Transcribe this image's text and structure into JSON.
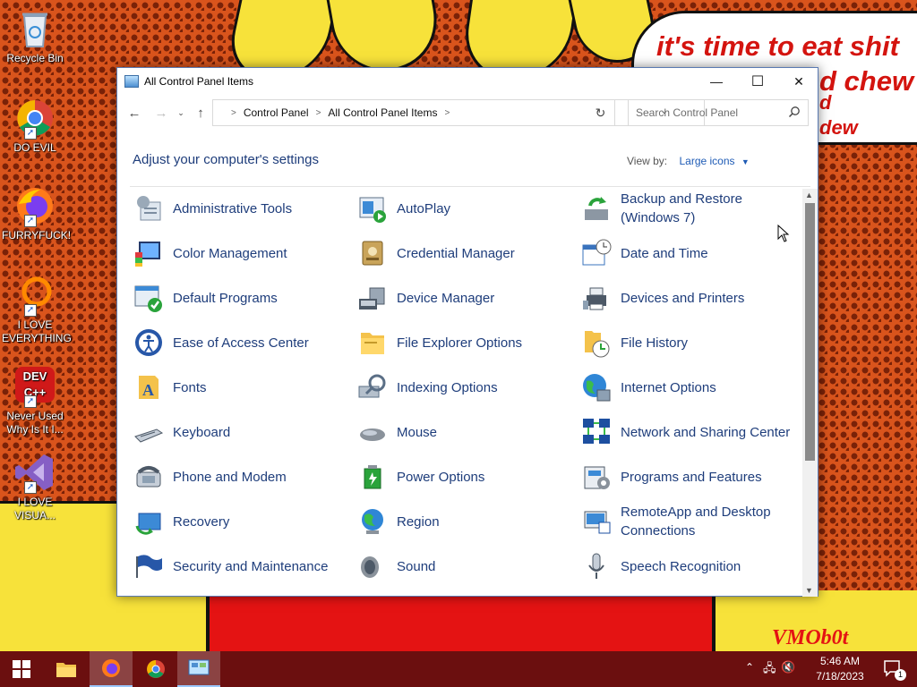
{
  "wallpaper": {
    "caption_line1": "it's time to eat shit",
    "caption_line2": "d chew",
    "caption_line3": "d",
    "caption_line4": "dew",
    "signature": "VMOb0t"
  },
  "desktop_icons": [
    {
      "label": "Recycle Bin",
      "icon": "recycle-bin-icon"
    },
    {
      "label": "DO EVIL",
      "icon": "chrome-icon"
    },
    {
      "label": "FURRYFUCK!",
      "icon": "firefox-icon"
    },
    {
      "label": "I LOVE EVERYTHING",
      "icon": "ring-icon"
    },
    {
      "label": "Never Used Why Is It I...",
      "icon": "devcpp-icon"
    },
    {
      "label": "I LOVE VISUA...",
      "icon": "visual-studio-icon"
    }
  ],
  "devcpp_badge": "DEV C++",
  "window": {
    "title": "All Control Panel Items",
    "minimize": "—",
    "maximize": "☐",
    "close": "✕",
    "breadcrumb": [
      "Control Panel",
      "All Control Panel Items"
    ],
    "search_placeholder": "Search Control Panel",
    "heading": "Adjust your computer's settings",
    "view_by_label": "View by:",
    "view_by_value": "Large icons",
    "items": [
      {
        "label": "Administrative Tools",
        "icon": "admin-tools-icon"
      },
      {
        "label": "AutoPlay",
        "icon": "autoplay-icon"
      },
      {
        "label": "Backup and Restore (Windows 7)",
        "icon": "backup-restore-icon"
      },
      {
        "label": "Color Management",
        "icon": "color-management-icon"
      },
      {
        "label": "Credential Manager",
        "icon": "credential-manager-icon"
      },
      {
        "label": "Date and Time",
        "icon": "date-time-icon"
      },
      {
        "label": "Default Programs",
        "icon": "default-programs-icon"
      },
      {
        "label": "Device Manager",
        "icon": "device-manager-icon"
      },
      {
        "label": "Devices and Printers",
        "icon": "devices-printers-icon"
      },
      {
        "label": "Ease of Access Center",
        "icon": "ease-of-access-icon"
      },
      {
        "label": "File Explorer Options",
        "icon": "file-explorer-options-icon"
      },
      {
        "label": "File History",
        "icon": "file-history-icon"
      },
      {
        "label": "Fonts",
        "icon": "fonts-icon"
      },
      {
        "label": "Indexing Options",
        "icon": "indexing-options-icon"
      },
      {
        "label": "Internet Options",
        "icon": "internet-options-icon"
      },
      {
        "label": "Keyboard",
        "icon": "keyboard-icon"
      },
      {
        "label": "Mouse",
        "icon": "mouse-icon"
      },
      {
        "label": "Network and Sharing Center",
        "icon": "network-sharing-icon"
      },
      {
        "label": "Phone and Modem",
        "icon": "phone-modem-icon"
      },
      {
        "label": "Power Options",
        "icon": "power-options-icon"
      },
      {
        "label": "Programs and Features",
        "icon": "programs-features-icon"
      },
      {
        "label": "Recovery",
        "icon": "recovery-icon"
      },
      {
        "label": "Region",
        "icon": "region-icon"
      },
      {
        "label": "RemoteApp and Desktop Connections",
        "icon": "remoteapp-icon"
      },
      {
        "label": "Security and Maintenance",
        "icon": "security-maintenance-icon"
      },
      {
        "label": "Sound",
        "icon": "sound-icon"
      },
      {
        "label": "Speech Recognition",
        "icon": "speech-recognition-icon"
      }
    ]
  },
  "taskbar": {
    "time": "5:46 AM",
    "date": "7/18/2023",
    "notification_count": "1"
  },
  "colors": {
    "link_blue": "#1e3d7b",
    "accent_blue": "#1e5bb5",
    "taskbar": "#6b0f0f"
  }
}
